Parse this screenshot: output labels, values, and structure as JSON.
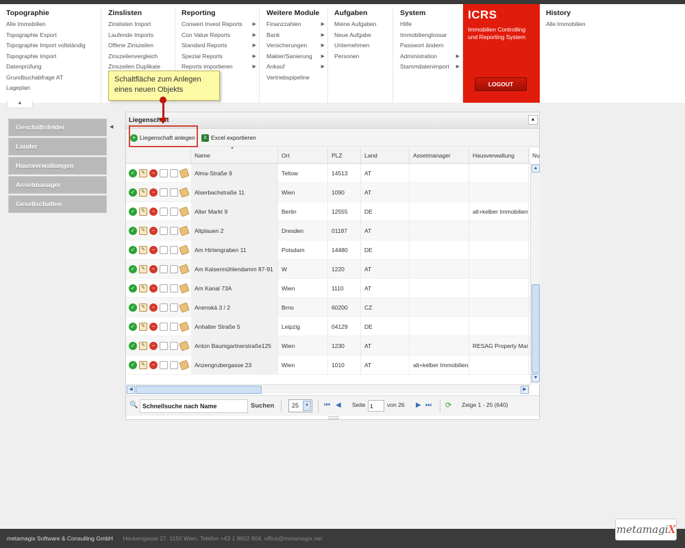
{
  "menu": {
    "columns": [
      {
        "title": "Topographie",
        "items": [
          {
            "label": "Alle Immobilien",
            "sub": false
          },
          {
            "label": "Topographie Export",
            "sub": false
          },
          {
            "label": "Topographie Import vollständig",
            "sub": false
          },
          {
            "label": "Topographie Import",
            "sub": false
          },
          {
            "label": "Datenprüfung",
            "sub": false
          },
          {
            "label": "Grundbuchabfrage AT",
            "sub": false
          },
          {
            "label": "Lageplan",
            "sub": false
          }
        ]
      },
      {
        "title": "Zinslisten",
        "items": [
          {
            "label": "Zinslisten Import",
            "sub": false
          },
          {
            "label": "Laufende Imports",
            "sub": false
          },
          {
            "label": "Offene Zinszeilen",
            "sub": false
          },
          {
            "label": "Zinszeilenvergleich",
            "sub": false
          },
          {
            "label": "Zinszeilen Duplikate",
            "sub": false
          }
        ]
      },
      {
        "title": "Reporting",
        "items": [
          {
            "label": "Conwert Invest Reports",
            "sub": true
          },
          {
            "label": "Con Value Reports",
            "sub": true
          },
          {
            "label": "Standard Reports",
            "sub": true
          },
          {
            "label": "Spezial Reports",
            "sub": true
          },
          {
            "label": "Reports importieren",
            "sub": true
          }
        ]
      },
      {
        "title": "Weitere Module",
        "items": [
          {
            "label": "Finanzzahlen",
            "sub": true
          },
          {
            "label": "Bank",
            "sub": true
          },
          {
            "label": "Versicherungen",
            "sub": true
          },
          {
            "label": "Makler/Sanierung",
            "sub": true
          },
          {
            "label": "Ankauf",
            "sub": true
          },
          {
            "label": "Vertriebspipeline",
            "sub": false
          }
        ]
      },
      {
        "title": "Aufgaben",
        "items": [
          {
            "label": "Meine Aufgaben",
            "sub": false
          },
          {
            "label": "Neue Aufgabe",
            "sub": false
          },
          {
            "label": "Unternehmen",
            "sub": false
          },
          {
            "label": "Personen",
            "sub": false
          }
        ]
      },
      {
        "title": "System",
        "items": [
          {
            "label": "Hilfe",
            "sub": false
          },
          {
            "label": "Immobilienglossar",
            "sub": false
          },
          {
            "label": "Passwort ändern",
            "sub": false
          },
          {
            "label": "Administration",
            "sub": true
          },
          {
            "label": "Stammdatenimport",
            "sub": true
          }
        ]
      },
      {
        "title": "History",
        "items": [
          {
            "label": "Alle Immobilien",
            "sub": false
          }
        ]
      }
    ],
    "icrs": {
      "title": "ICRS",
      "subtitle": "Immobilien Controlling und Reporting System",
      "logout": "LOGOUT"
    }
  },
  "sidebar": {
    "items": [
      {
        "label": "Geschäftsfelder"
      },
      {
        "label": "Länder"
      },
      {
        "label": "Hausverwaltungen"
      },
      {
        "label": "Assetmanager"
      },
      {
        "label": "Gesellschaften"
      }
    ]
  },
  "callout": {
    "text": "Schaltfläche zum Anlegen eines neuen Objekts"
  },
  "panel": {
    "title": "Liegenschaft",
    "toolbar": {
      "new_label": "Liegenschaft anlegen",
      "export_label": "Excel exportieren"
    },
    "columns": [
      "Name",
      "Ort",
      "PLZ",
      "Land",
      "Assetmanager",
      "Hausverwaltung",
      "Nu"
    ],
    "rows": [
      {
        "name": "Alma-Straße 9",
        "ort": "Teltow",
        "plz": "14513",
        "land": "AT",
        "assetmanager": "",
        "hausverwaltung": ""
      },
      {
        "name": "Alserbachstraße 11",
        "ort": "Wien",
        "plz": "1090",
        "land": "AT",
        "assetmanager": "",
        "hausverwaltung": ""
      },
      {
        "name": "Alter Markt 9",
        "ort": "Berlin",
        "plz": "12555",
        "land": "DE",
        "assetmanager": "",
        "hausverwaltung": "alt+kelber Immobilienve"
      },
      {
        "name": "Altplauen 2",
        "ort": "Dresden",
        "plz": "01187",
        "land": "AT",
        "assetmanager": "",
        "hausverwaltung": ""
      },
      {
        "name": "Am Hirtengraben 11",
        "ort": "Potsdam",
        "plz": "14480",
        "land": "DE",
        "assetmanager": "",
        "hausverwaltung": ""
      },
      {
        "name": "Am Kaisermühlendamm 87-91",
        "ort": "W",
        "plz": "1220",
        "land": "AT",
        "assetmanager": "",
        "hausverwaltung": ""
      },
      {
        "name": "Am Kanal 73A",
        "ort": "Wien",
        "plz": "1110",
        "land": "AT",
        "assetmanager": "",
        "hausverwaltung": ""
      },
      {
        "name": "Anenská 3 / 2",
        "ort": "Brno",
        "plz": "60200",
        "land": "CZ",
        "assetmanager": "",
        "hausverwaltung": ""
      },
      {
        "name": "Anhalter Straße 5",
        "ort": "Leipzig",
        "plz": "04129",
        "land": "DE",
        "assetmanager": "",
        "hausverwaltung": ""
      },
      {
        "name": "Anton Baumgartnerstraße125",
        "ort": "Wien",
        "plz": "1230",
        "land": "AT",
        "assetmanager": "",
        "hausverwaltung": "RESAG Property Mana"
      },
      {
        "name": "Anzengrubergasse 23",
        "ort": "Wien",
        "plz": "1010",
        "land": "AT",
        "assetmanager": "alt+kelber Immobilienge",
        "hausverwaltung": ""
      }
    ],
    "pager": {
      "search_value": "Schnellsuche nach Name",
      "search_button": "Suchen",
      "page_size": "25",
      "page_label": "Seite",
      "page_value": "1",
      "of_label": "von 26",
      "summary": "Zeige 1 - 25 (640)"
    }
  },
  "footer": {
    "company": "metamagix Software & Consulting GmbH",
    "address": "Heckengasse 27, 1150 Wien, Telefon +43 1 9902 804, office@metamagix.net",
    "logo": "metamagi",
    "logo_accent": "X"
  },
  "colors": {
    "accent": "#e21c0c",
    "highlight": "#fdfaa6"
  }
}
